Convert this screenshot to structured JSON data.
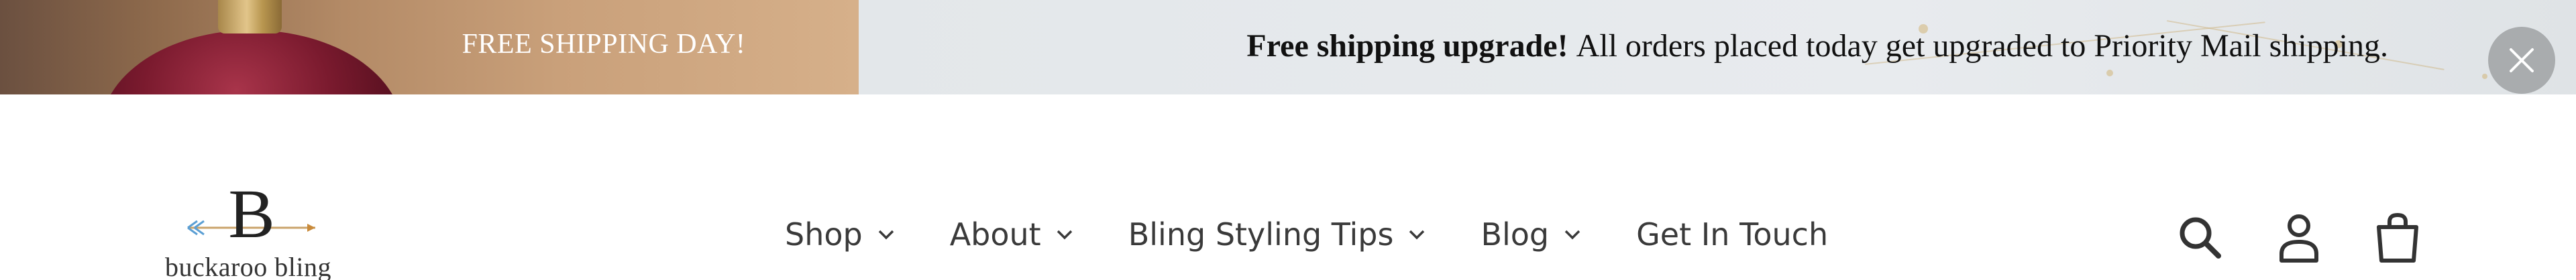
{
  "announcement": {
    "title": "FREE SHIPPING DAY!",
    "message_bold": "Free shipping upgrade!",
    "message": "All orders placed today get upgraded to Priority Mail shipping.",
    "close_icon": "close-icon",
    "colors": {
      "left_bg": "#b38a66",
      "right_bg": "#e5e9ec",
      "close_bg": "#a9acae",
      "ornament": "#7a1a2e"
    }
  },
  "header": {
    "logo": {
      "letter": "B",
      "text": "buckaroo bling"
    },
    "nav": [
      {
        "label": "Shop",
        "has_dropdown": true
      },
      {
        "label": "About",
        "has_dropdown": true
      },
      {
        "label": "Bling Styling Tips",
        "has_dropdown": true
      },
      {
        "label": "Blog",
        "has_dropdown": true
      },
      {
        "label": "Get In Touch",
        "has_dropdown": false
      }
    ],
    "icons": [
      "search-icon",
      "account-icon",
      "cart-icon"
    ],
    "colors": {
      "text": "#3a3a3a",
      "icon": "#333333"
    }
  }
}
